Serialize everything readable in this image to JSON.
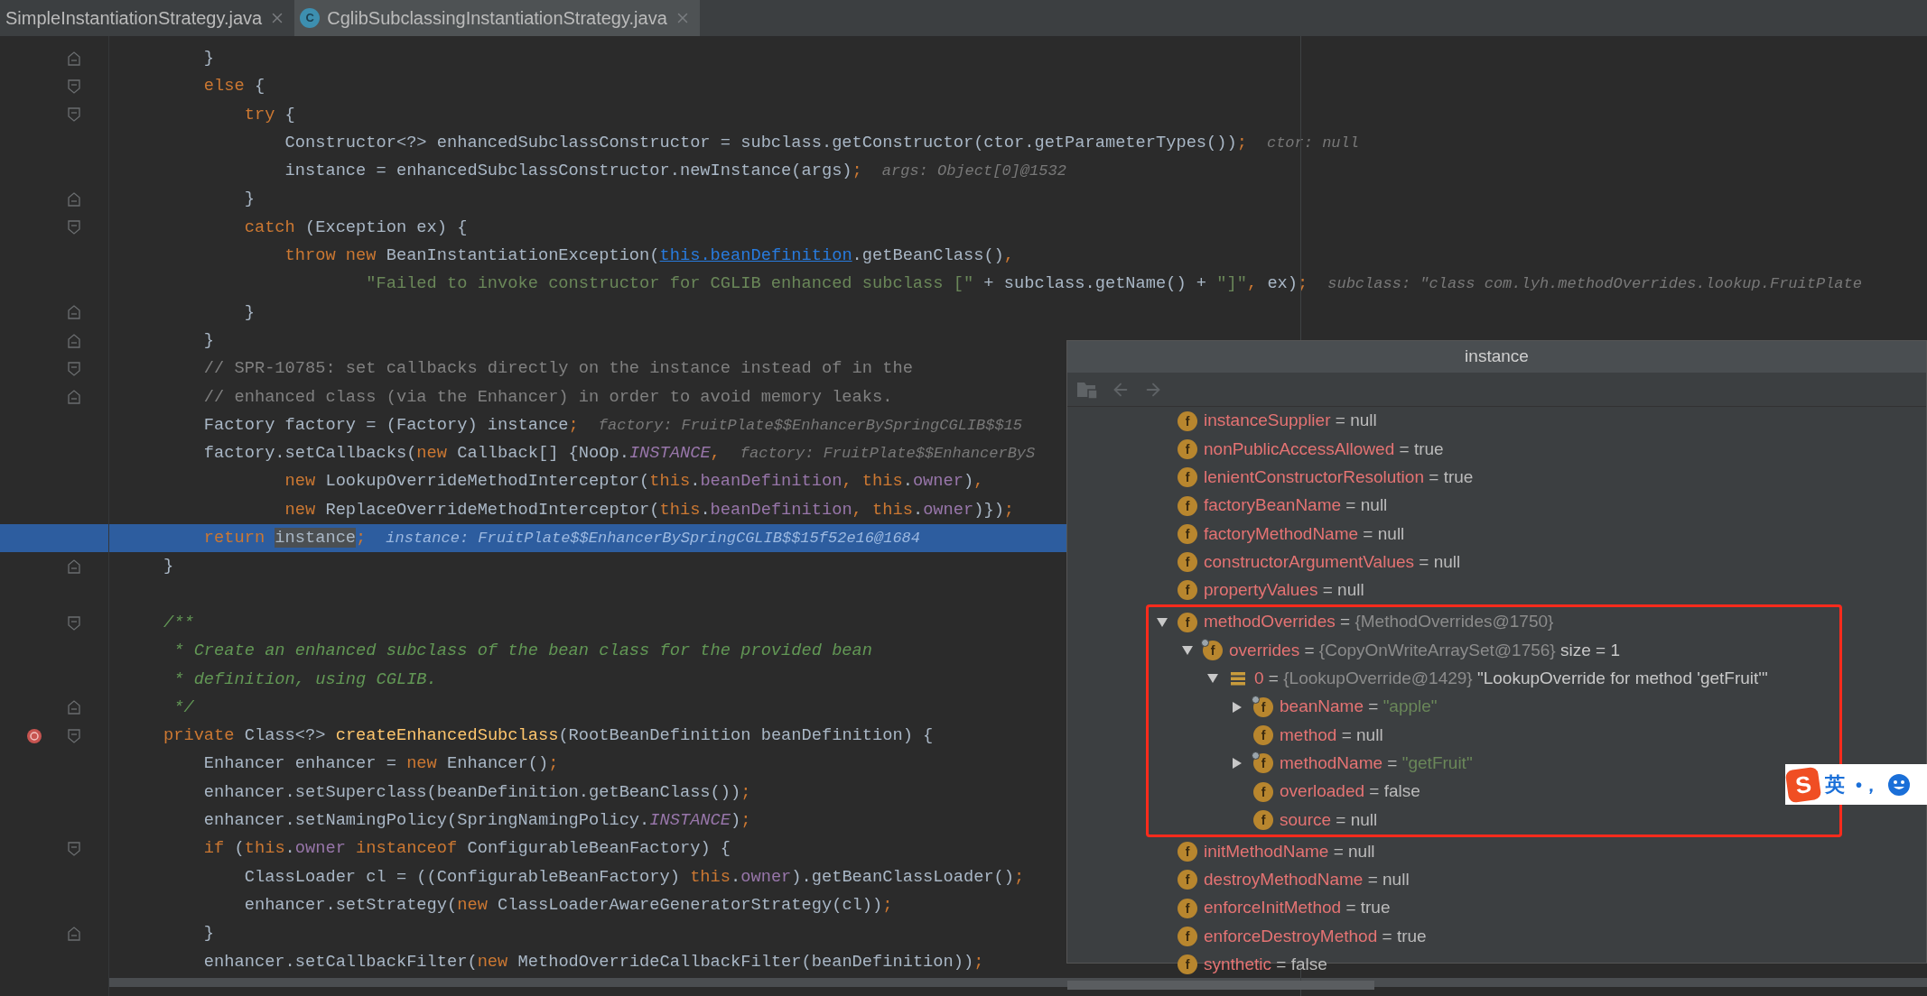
{
  "tabs": [
    {
      "label": "SimpleInstantiationStrategy.java",
      "selected": false,
      "kind": "plain"
    },
    {
      "label": "CglibSubclassingInstantiationStrategy.java",
      "selected": true,
      "kind": "class",
      "icon_letter": "C"
    }
  ],
  "editor": {
    "lines": [
      {
        "tokens": [
          {
            "kind": "p",
            "text": "    }"
          }
        ],
        "gutter": [
          {
            "kind": "fold-end"
          }
        ],
        "current": false
      },
      {
        "tokens": [
          {
            "kind": "kw",
            "text": "    else"
          },
          {
            "kind": "p",
            "text": " {"
          }
        ],
        "gutter": [
          {
            "kind": "fold-start"
          }
        ],
        "current": false
      },
      {
        "tokens": [
          {
            "kind": "kw",
            "text": "        try"
          },
          {
            "kind": "p",
            "text": " {"
          }
        ],
        "gutter": [
          {
            "kind": "fold-start"
          }
        ],
        "current": false
      },
      {
        "tokens": [
          {
            "kind": "p",
            "text": "            Constructor<?> enhancedSubclassConstructor = subclass.getConstructor(ctor.getParameterTypes())"
          },
          {
            "kind": "kw",
            "text": ";"
          }
        ],
        "hint": "ctor: null",
        "current": false
      },
      {
        "tokens": [
          {
            "kind": "p",
            "text": "            instance = enhancedSubclassConstructor.newInstance(args)"
          },
          {
            "kind": "kw",
            "text": ";"
          }
        ],
        "hint": "args: Object[0]@1532",
        "current": false
      },
      {
        "tokens": [
          {
            "kind": "p",
            "text": "        }"
          }
        ],
        "gutter": [
          {
            "kind": "fold-end"
          }
        ],
        "current": false
      },
      {
        "tokens": [
          {
            "kind": "kw",
            "text": "        catch"
          },
          {
            "kind": "p",
            "text": " (Exception ex) {"
          }
        ],
        "gutter": [
          {
            "kind": "fold-start"
          }
        ],
        "current": false
      },
      {
        "tokens": [
          {
            "kind": "kw",
            "text": "            throw new"
          },
          {
            "kind": "p",
            "text": " BeanInstantiationException("
          },
          {
            "kind": "link",
            "text": "this.beanDefinition"
          },
          {
            "kind": "p",
            "text": ".getBeanClass()"
          },
          {
            "kind": "kw",
            "text": ","
          }
        ],
        "current": false
      },
      {
        "tokens": [
          {
            "kind": "str",
            "text": "                    \"Failed to invoke constructor for CGLIB enhanced subclass [\""
          },
          {
            "kind": "p",
            "text": " + subclass.getName() + "
          },
          {
            "kind": "str",
            "text": "\"]\""
          },
          {
            "kind": "kw",
            "text": ","
          },
          {
            "kind": "p",
            "text": " ex)"
          },
          {
            "kind": "kw",
            "text": ";"
          }
        ],
        "hint": "subclass: \"class com.lyh.methodOverrides.lookup.FruitPlate",
        "current": false
      },
      {
        "tokens": [
          {
            "kind": "p",
            "text": "        }"
          }
        ],
        "gutter": [
          {
            "kind": "fold-end"
          }
        ],
        "current": false
      },
      {
        "tokens": [
          {
            "kind": "p",
            "text": "    }"
          }
        ],
        "gutter": [
          {
            "kind": "fold-end"
          }
        ],
        "current": false
      },
      {
        "tokens": [
          {
            "kind": "cm",
            "text": "    // SPR-10785: set callbacks directly on the instance instead of in the"
          }
        ],
        "gutter": [
          {
            "kind": "fold-start"
          }
        ],
        "current": false
      },
      {
        "tokens": [
          {
            "kind": "cm",
            "text": "    // enhanced class (via the Enhancer) in order to avoid memory leaks."
          }
        ],
        "gutter": [
          {
            "kind": "fold-end"
          }
        ],
        "current": false
      },
      {
        "tokens": [
          {
            "kind": "p",
            "text": "    Factory factory = (Factory) instance"
          },
          {
            "kind": "kw",
            "text": ";"
          }
        ],
        "hint": "factory: FruitPlate$$EnhancerBySpringCGLIB$$15",
        "current": false
      },
      {
        "tokens": [
          {
            "kind": "p",
            "text": "    factory.setCallbacks("
          },
          {
            "kind": "kw",
            "text": "new"
          },
          {
            "kind": "p",
            "text": " Callback[] {NoOp."
          },
          {
            "kind": "st",
            "text": "INSTANCE"
          },
          {
            "kind": "kw",
            "text": ","
          }
        ],
        "hint": "factory: FruitPlate$$EnhancerByS",
        "current": false
      },
      {
        "tokens": [
          {
            "kind": "kw",
            "text": "            new"
          },
          {
            "kind": "p",
            "text": " LookupOverrideMethodInterceptor("
          },
          {
            "kind": "kw",
            "text": "this"
          },
          {
            "kind": "p",
            "text": "."
          },
          {
            "kind": "fld",
            "text": "beanDefinition"
          },
          {
            "kind": "kw",
            "text": ", this"
          },
          {
            "kind": "p",
            "text": "."
          },
          {
            "kind": "fld",
            "text": "owner"
          },
          {
            "kind": "p",
            "text": ")"
          },
          {
            "kind": "kw",
            "text": ","
          }
        ],
        "current": false
      },
      {
        "tokens": [
          {
            "kind": "kw",
            "text": "            new"
          },
          {
            "kind": "p",
            "text": " ReplaceOverrideMethodInterceptor("
          },
          {
            "kind": "kw",
            "text": "this"
          },
          {
            "kind": "p",
            "text": "."
          },
          {
            "kind": "fld",
            "text": "beanDefinition"
          },
          {
            "kind": "kw",
            "text": ", this"
          },
          {
            "kind": "p",
            "text": "."
          },
          {
            "kind": "fld",
            "text": "owner"
          },
          {
            "kind": "p",
            "text": ")})"
          },
          {
            "kind": "kw",
            "text": ";"
          }
        ],
        "current": false
      },
      {
        "tokens": [
          {
            "kind": "kw",
            "text": "    return "
          },
          {
            "kind": "sel",
            "text": "instance"
          },
          {
            "kind": "kw",
            "text": ";"
          }
        ],
        "hint": "instance: FruitPlate$$EnhancerBySpringCGLIB$$15f52e16@1684",
        "current": true
      },
      {
        "tokens": [
          {
            "kind": "p",
            "text": "}"
          }
        ],
        "gutter": [
          {
            "kind": "fold-end"
          }
        ],
        "current": false
      },
      {
        "kind": "blank"
      },
      {
        "tokens": [
          {
            "kind": "doc",
            "text": "/**"
          }
        ],
        "gutter": [
          {
            "kind": "fold-start"
          }
        ],
        "current": false
      },
      {
        "tokens": [
          {
            "kind": "doc",
            "text": " * Create an enhanced subclass of the bean class for the provided bean"
          }
        ],
        "current": false
      },
      {
        "tokens": [
          {
            "kind": "doc",
            "text": " * definition, using CGLIB."
          }
        ],
        "current": false
      },
      {
        "tokens": [
          {
            "kind": "doc",
            "text": " */"
          }
        ],
        "gutter": [
          {
            "kind": "fold-end"
          }
        ],
        "current": false
      },
      {
        "tokens": [
          {
            "kind": "kw",
            "text": "private"
          },
          {
            "kind": "p",
            "text": " Class<?> "
          },
          {
            "kind": "fn",
            "text": "createEnhancedSubclass"
          },
          {
            "kind": "p",
            "text": "(RootBeanDefinition beanDefinition) {"
          }
        ],
        "gutter": [
          {
            "kind": "method-breakpoint"
          },
          {
            "kind": "fold-start"
          }
        ],
        "current": false
      },
      {
        "tokens": [
          {
            "kind": "p",
            "text": "    Enhancer enhancer = "
          },
          {
            "kind": "kw",
            "text": "new"
          },
          {
            "kind": "p",
            "text": " Enhancer()"
          },
          {
            "kind": "kw",
            "text": ";"
          }
        ],
        "current": false
      },
      {
        "tokens": [
          {
            "kind": "p",
            "text": "    enhancer.setSuperclass(beanDefinition.getBeanClass())"
          },
          {
            "kind": "kw",
            "text": ";"
          }
        ],
        "current": false
      },
      {
        "tokens": [
          {
            "kind": "p",
            "text": "    enhancer.setNamingPolicy(SpringNamingPolicy."
          },
          {
            "kind": "st",
            "text": "INSTANCE"
          },
          {
            "kind": "p",
            "text": ")"
          },
          {
            "kind": "kw",
            "text": ";"
          }
        ],
        "current": false
      },
      {
        "tokens": [
          {
            "kind": "kw",
            "text": "    if"
          },
          {
            "kind": "p",
            "text": " ("
          },
          {
            "kind": "kw",
            "text": "this"
          },
          {
            "kind": "p",
            "text": "."
          },
          {
            "kind": "fld",
            "text": "owner"
          },
          {
            "kind": "kw",
            "text": " instanceof"
          },
          {
            "kind": "p",
            "text": " ConfigurableBeanFactory) {"
          }
        ],
        "gutter": [
          {
            "kind": "fold-start"
          }
        ],
        "current": false
      },
      {
        "tokens": [
          {
            "kind": "p",
            "text": "        ClassLoader cl = ((ConfigurableBeanFactory) "
          },
          {
            "kind": "kw",
            "text": "this"
          },
          {
            "kind": "p",
            "text": "."
          },
          {
            "kind": "fld",
            "text": "owner"
          },
          {
            "kind": "p",
            "text": ").getBeanClassLoader()"
          },
          {
            "kind": "kw",
            "text": ";"
          }
        ],
        "current": false
      },
      {
        "tokens": [
          {
            "kind": "p",
            "text": "        enhancer.setStrategy("
          },
          {
            "kind": "kw",
            "text": "new"
          },
          {
            "kind": "p",
            "text": " ClassLoaderAwareGeneratorStrategy(cl))"
          },
          {
            "kind": "kw",
            "text": ";"
          }
        ],
        "current": false
      },
      {
        "tokens": [
          {
            "kind": "p",
            "text": "    }"
          }
        ],
        "gutter": [
          {
            "kind": "fold-end"
          }
        ],
        "current": false
      },
      {
        "tokens": [
          {
            "kind": "p",
            "text": "    enhancer.setCallbackFilter("
          },
          {
            "kind": "kw",
            "text": "new"
          },
          {
            "kind": "p",
            "text": " MethodOverrideCallbackFilter(beanDefinition))"
          },
          {
            "kind": "kw",
            "text": ";"
          }
        ],
        "current": false
      }
    ]
  },
  "popup": {
    "title": "instance",
    "toolbar": [
      {
        "kind": "restore",
        "disabled": true
      },
      {
        "kind": "back",
        "disabled": true
      },
      {
        "kind": "forward",
        "disabled": true
      }
    ],
    "tree": [
      {
        "kind": "field",
        "icon_letter": "f",
        "name": "instanceSupplier",
        "sign": "=",
        "value": {
          "kind": "plain",
          "text": "null"
        }
      },
      {
        "kind": "field",
        "icon_letter": "f",
        "name": "nonPublicAccessAllowed",
        "sign": "=",
        "value": {
          "kind": "plain",
          "text": "true"
        }
      },
      {
        "kind": "field",
        "icon_letter": "f",
        "name": "lenientConstructorResolution",
        "sign": "=",
        "value": {
          "kind": "plain",
          "text": "true"
        }
      },
      {
        "kind": "field",
        "icon_letter": "f",
        "name": "factoryBeanName",
        "sign": "=",
        "value": {
          "kind": "plain",
          "text": "null"
        }
      },
      {
        "kind": "field",
        "icon_letter": "f",
        "name": "factoryMethodName",
        "sign": "=",
        "value": {
          "kind": "plain",
          "text": "null"
        }
      },
      {
        "kind": "field",
        "icon_letter": "f",
        "name": "constructorArgumentValues",
        "sign": "=",
        "value": {
          "kind": "plain",
          "text": "null"
        }
      },
      {
        "kind": "field",
        "icon_letter": "f",
        "name": "propertyValues",
        "sign": "=",
        "value": {
          "kind": "plain",
          "text": "null"
        }
      },
      {
        "kind": "field",
        "icon_letter": "f",
        "name": "methodOverrides",
        "sign": "=",
        "value": {
          "kind": "ref",
          "text": "{MethodOverrides@1750}"
        },
        "expanded": true,
        "highlighted": true,
        "children": [
          {
            "kind": "final-field",
            "icon_letter": "f",
            "name": "overrides",
            "sign": "=",
            "value": {
              "kind": "ref",
              "text": "{CopyOnWriteArraySet@1756}"
            },
            "note": "size = 1",
            "expanded": true,
            "children": [
              {
                "kind": "element",
                "name": "0",
                "sign": "=",
                "value": {
                  "kind": "ref",
                  "text": "{LookupOverride@1429}"
                },
                "note": "\"LookupOverride for method 'getFruit'\"",
                "expanded": true,
                "children": [
                  {
                    "kind": "final-field",
                    "icon_letter": "f",
                    "name": "beanName",
                    "sign": "=",
                    "value": {
                      "kind": "string",
                      "text": "\"apple\""
                    },
                    "expanded": false
                  },
                  {
                    "kind": "field",
                    "icon_letter": "f",
                    "name": "method",
                    "sign": "=",
                    "value": {
                      "kind": "plain",
                      "text": "null"
                    }
                  },
                  {
                    "kind": "final-field",
                    "icon_letter": "f",
                    "name": "methodName",
                    "sign": "=",
                    "value": {
                      "kind": "string",
                      "text": "\"getFruit\""
                    },
                    "expanded": false
                  },
                  {
                    "kind": "field",
                    "icon_letter": "f",
                    "name": "overloaded",
                    "sign": "=",
                    "value": {
                      "kind": "plain",
                      "text": "false"
                    }
                  },
                  {
                    "kind": "field",
                    "icon_letter": "f",
                    "name": "source",
                    "sign": "=",
                    "value": {
                      "kind": "plain",
                      "text": "null"
                    }
                  }
                ]
              }
            ]
          }
        ]
      },
      {
        "kind": "field",
        "icon_letter": "f",
        "name": "initMethodName",
        "sign": "=",
        "value": {
          "kind": "plain",
          "text": "null"
        }
      },
      {
        "kind": "field",
        "icon_letter": "f",
        "name": "destroyMethodName",
        "sign": "=",
        "value": {
          "kind": "plain",
          "text": "null"
        }
      },
      {
        "kind": "field",
        "icon_letter": "f",
        "name": "enforceInitMethod",
        "sign": "=",
        "value": {
          "kind": "plain",
          "text": "true"
        }
      },
      {
        "kind": "field",
        "icon_letter": "f",
        "name": "enforceDestroyMethod",
        "sign": "=",
        "value": {
          "kind": "plain",
          "text": "true"
        }
      },
      {
        "kind": "field",
        "icon_letter": "f",
        "name": "synthetic",
        "sign": "=",
        "value": {
          "kind": "plain",
          "text": "false"
        }
      }
    ]
  },
  "ime_bar": {
    "logo": "S",
    "mode": "英",
    "punctuation": "•，"
  }
}
